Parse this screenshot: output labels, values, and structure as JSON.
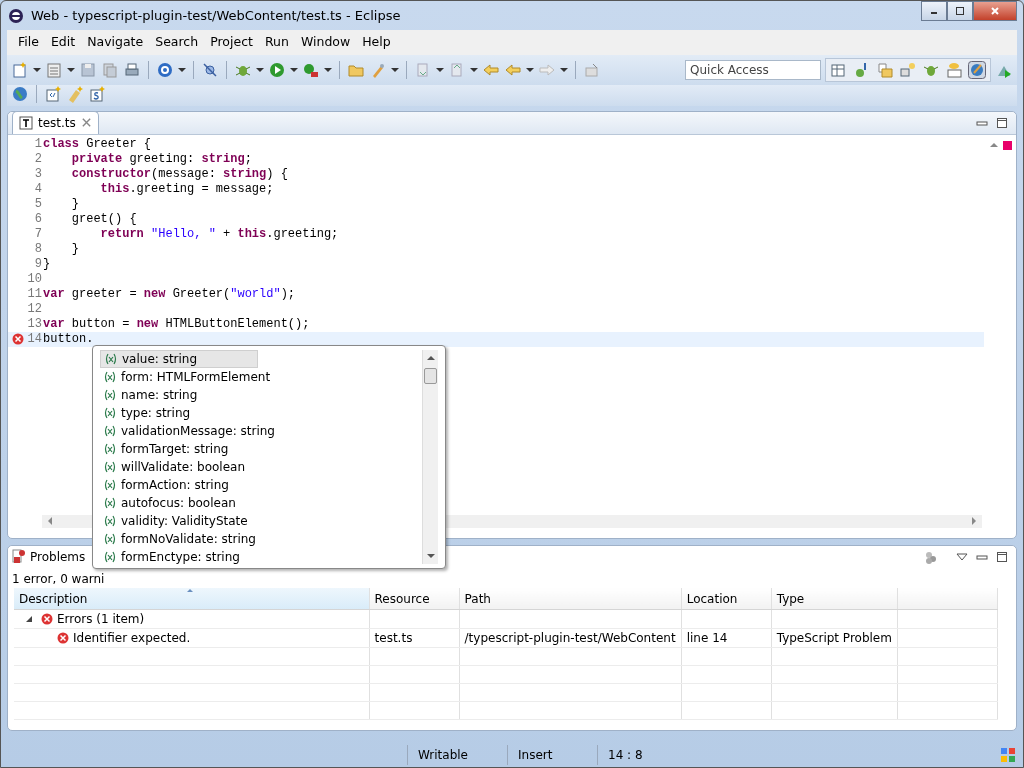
{
  "window": {
    "title": "Web - typescript-plugin-test/WebContent/test.ts - Eclipse"
  },
  "menu": [
    {
      "label": "File"
    },
    {
      "label": "Edit"
    },
    {
      "label": "Navigate"
    },
    {
      "label": "Search"
    },
    {
      "label": "Project"
    },
    {
      "label": "Run"
    },
    {
      "label": "Window"
    },
    {
      "label": "Help"
    }
  ],
  "quick_access": {
    "placeholder": "Quick Access"
  },
  "editor": {
    "tabs": [
      {
        "label": "test.ts",
        "selected": true
      }
    ],
    "lines": [
      {
        "number": "1",
        "error": false,
        "current": false,
        "tokens": [
          {
            "kind": "kw",
            "text": "class"
          },
          {
            "kind": "plain",
            "text": " Greeter {"
          }
        ]
      },
      {
        "number": "2",
        "error": false,
        "current": false,
        "tokens": [
          {
            "kind": "kw",
            "text": "    private"
          },
          {
            "kind": "plain",
            "text": " greeting: "
          },
          {
            "kind": "kw",
            "text": "string"
          },
          {
            "kind": "plain",
            "text": ";"
          }
        ]
      },
      {
        "number": "3",
        "error": false,
        "current": false,
        "tokens": [
          {
            "kind": "kw",
            "text": "    constructor"
          },
          {
            "kind": "plain",
            "text": "(message: "
          },
          {
            "kind": "kw",
            "text": "string"
          },
          {
            "kind": "plain",
            "text": ") {"
          }
        ]
      },
      {
        "number": "4",
        "error": false,
        "current": false,
        "tokens": [
          {
            "kind": "kw",
            "text": "        this"
          },
          {
            "kind": "plain",
            "text": ".greeting = message;"
          }
        ]
      },
      {
        "number": "5",
        "error": false,
        "current": false,
        "tokens": [
          {
            "kind": "plain",
            "text": "    }"
          }
        ]
      },
      {
        "number": "6",
        "error": false,
        "current": false,
        "tokens": [
          {
            "kind": "plain",
            "text": "    greet() {"
          }
        ]
      },
      {
        "number": "7",
        "error": false,
        "current": false,
        "tokens": [
          {
            "kind": "kw",
            "text": "        return"
          },
          {
            "kind": "str",
            "text": " \"Hello, \""
          },
          {
            "kind": "plain",
            "text": " + "
          },
          {
            "kind": "kw",
            "text": "this"
          },
          {
            "kind": "plain",
            "text": ".greeting;"
          }
        ]
      },
      {
        "number": "8",
        "error": false,
        "current": false,
        "tokens": [
          {
            "kind": "plain",
            "text": "    }"
          }
        ]
      },
      {
        "number": "9",
        "error": false,
        "current": false,
        "tokens": [
          {
            "kind": "plain",
            "text": "}"
          }
        ]
      },
      {
        "number": "10",
        "error": false,
        "current": false
      },
      {
        "number": "11",
        "error": false,
        "current": false,
        "tokens": [
          {
            "kind": "kw",
            "text": "var"
          },
          {
            "kind": "plain",
            "text": " greeter = "
          },
          {
            "kind": "kw",
            "text": "new"
          },
          {
            "kind": "plain",
            "text": " Greeter("
          },
          {
            "kind": "str",
            "text": "\"world\""
          },
          {
            "kind": "plain",
            "text": ");"
          }
        ]
      },
      {
        "number": "12",
        "error": false,
        "current": false
      },
      {
        "number": "13",
        "error": false,
        "current": false,
        "tokens": [
          {
            "kind": "kw",
            "text": "var"
          },
          {
            "kind": "plain",
            "text": " button = "
          },
          {
            "kind": "kw",
            "text": "new"
          },
          {
            "kind": "plain",
            "text": " HTMLButtonElement();"
          }
        ]
      },
      {
        "number": "14",
        "error": true,
        "current": true,
        "tokens": [
          {
            "kind": "plain",
            "text": "button."
          }
        ]
      }
    ]
  },
  "completion": {
    "items": [
      {
        "label": "value: string",
        "selected": true
      },
      {
        "label": "form: HTMLFormElement",
        "selected": false
      },
      {
        "label": "name: string",
        "selected": false
      },
      {
        "label": "type: string",
        "selected": false
      },
      {
        "label": "validationMessage: string",
        "selected": false
      },
      {
        "label": "formTarget: string",
        "selected": false
      },
      {
        "label": "willValidate: boolean",
        "selected": false
      },
      {
        "label": "formAction: string",
        "selected": false
      },
      {
        "label": "autofocus: boolean",
        "selected": false
      },
      {
        "label": "validity: ValidityState",
        "selected": false
      },
      {
        "label": "formNoValidate: string",
        "selected": false
      },
      {
        "label": "formEnctype: string",
        "selected": false
      }
    ]
  },
  "problems": {
    "tab": "Problems",
    "summary": "1 error, 0 warni",
    "columns": [
      {
        "label": "Description",
        "sorted": true
      },
      {
        "label": "Resource",
        "sorted": false
      },
      {
        "label": "Path",
        "sorted": false
      },
      {
        "label": "Location",
        "sorted": false
      },
      {
        "label": "Type",
        "sorted": false
      }
    ],
    "groups": [
      {
        "label": "Errors (1 item)",
        "expanded": true,
        "rows": [
          {
            "cells": [
              "Identifier expected.",
              "test.ts",
              "/typescript-plugin-test/WebContent",
              "line 14",
              "TypeScript Problem"
            ]
          }
        ]
      }
    ]
  },
  "status_bar": [
    "Writable",
    "Insert",
    "14 : 8"
  ]
}
